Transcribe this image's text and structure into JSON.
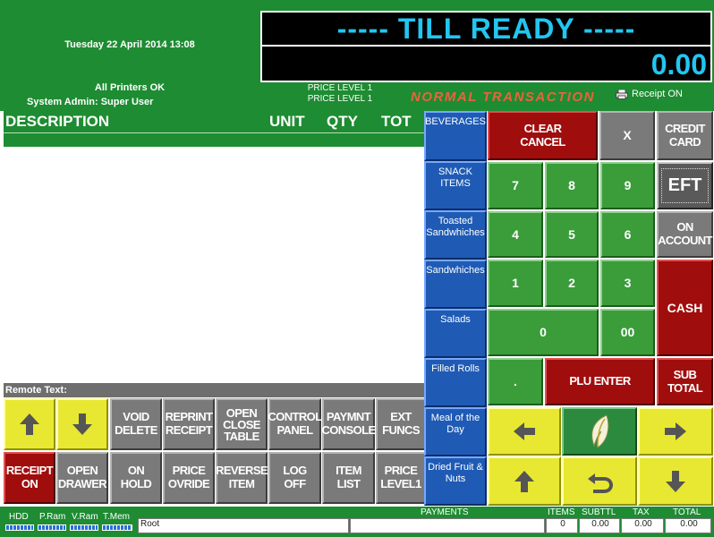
{
  "header": {
    "datetime": "Tuesday 22 April 2014  13:08",
    "printers_status": "All Printers OK",
    "user": "System Admin: Super User",
    "price_level_line1": "PRICE LEVEL 1",
    "price_level_line2": "PRICE LEVEL 1",
    "transaction_mode": "NORMAL TRANSACTION",
    "receipt_status": "Receipt ON",
    "till_message": "----- TILL READY -----",
    "amount": "0.00"
  },
  "receipt": {
    "col_description": "DESCRIPTION",
    "col_unit": "UNIT",
    "col_qty": "QTY",
    "col_tot": "TOT",
    "remote_text_label": "Remote Text:"
  },
  "function_keys": {
    "void_delete": "VOID\nDELETE",
    "reprint_receipt": "REPRINT\nRECEIPT",
    "open_close_table": "OPEN\nCLOSE\nTABLE",
    "control_panel": "CONTROL\nPANEL",
    "paymnt_console": "PAYMNT\nCONSOLE",
    "ext_funcs": "EXT\nFUNCS",
    "receipt_on": "RECEIPT\nON",
    "open_drawer": "OPEN\nDRAWER",
    "on_hold": "ON\nHOLD",
    "price_ovride": "PRICE\nOVRIDE",
    "reverse_item": "REVERSE\nITEM",
    "log_off": "LOG\nOFF",
    "item_list": "ITEM\nLIST",
    "price_level1": "PRICE\nLEVEL1"
  },
  "categories": [
    "BEVERAGES",
    "SNACK\nITEMS",
    "Toasted\nSandwhiches",
    "Sandwhiches",
    "Salads",
    "Filled Rolls",
    "Meal of the\nDay",
    "Dried Fruit &\nNuts"
  ],
  "keypad": {
    "clear_cancel": "CLEAR\nCANCEL",
    "x": "X",
    "credit_card": "CREDIT\nCARD",
    "eft": "EFT",
    "on_account": "ON\nACCOUNT",
    "cash": "CASH",
    "sub_total": "SUB\nTOTAL",
    "plu_enter": "PLU ENTER",
    "d7": "7",
    "d8": "8",
    "d9": "9",
    "d4": "4",
    "d5": "5",
    "d6": "6",
    "d1": "1",
    "d2": "2",
    "d3": "3",
    "d0": "0",
    "d00": "00",
    "dot": "."
  },
  "icons": {
    "up": "arrow-up-icon",
    "down": "arrow-down-icon",
    "left": "arrow-left-icon",
    "right": "arrow-right-icon",
    "return": "return-arrow-icon",
    "logo": "leaf-logo-icon",
    "printer": "printer-icon"
  },
  "status_bar": {
    "hdd": "HDD",
    "p_ram": "P.Ram",
    "v_ram": "V.Ram",
    "t_mem": "T.Mem",
    "path": "Root",
    "payments_label": "PAYMENTS",
    "items_label": "ITEMS",
    "subttl_label": "SUBTTL",
    "tax_label": "TAX",
    "total_label": "TOTAL",
    "items_value": "0",
    "subttl_value": "0.00",
    "tax_value": "0.00",
    "total_value": "0.00"
  },
  "colors": {
    "header_green": "#1e8c32",
    "till_text_cyan": "#22c6f0",
    "transaction_orange": "#e8643c"
  }
}
